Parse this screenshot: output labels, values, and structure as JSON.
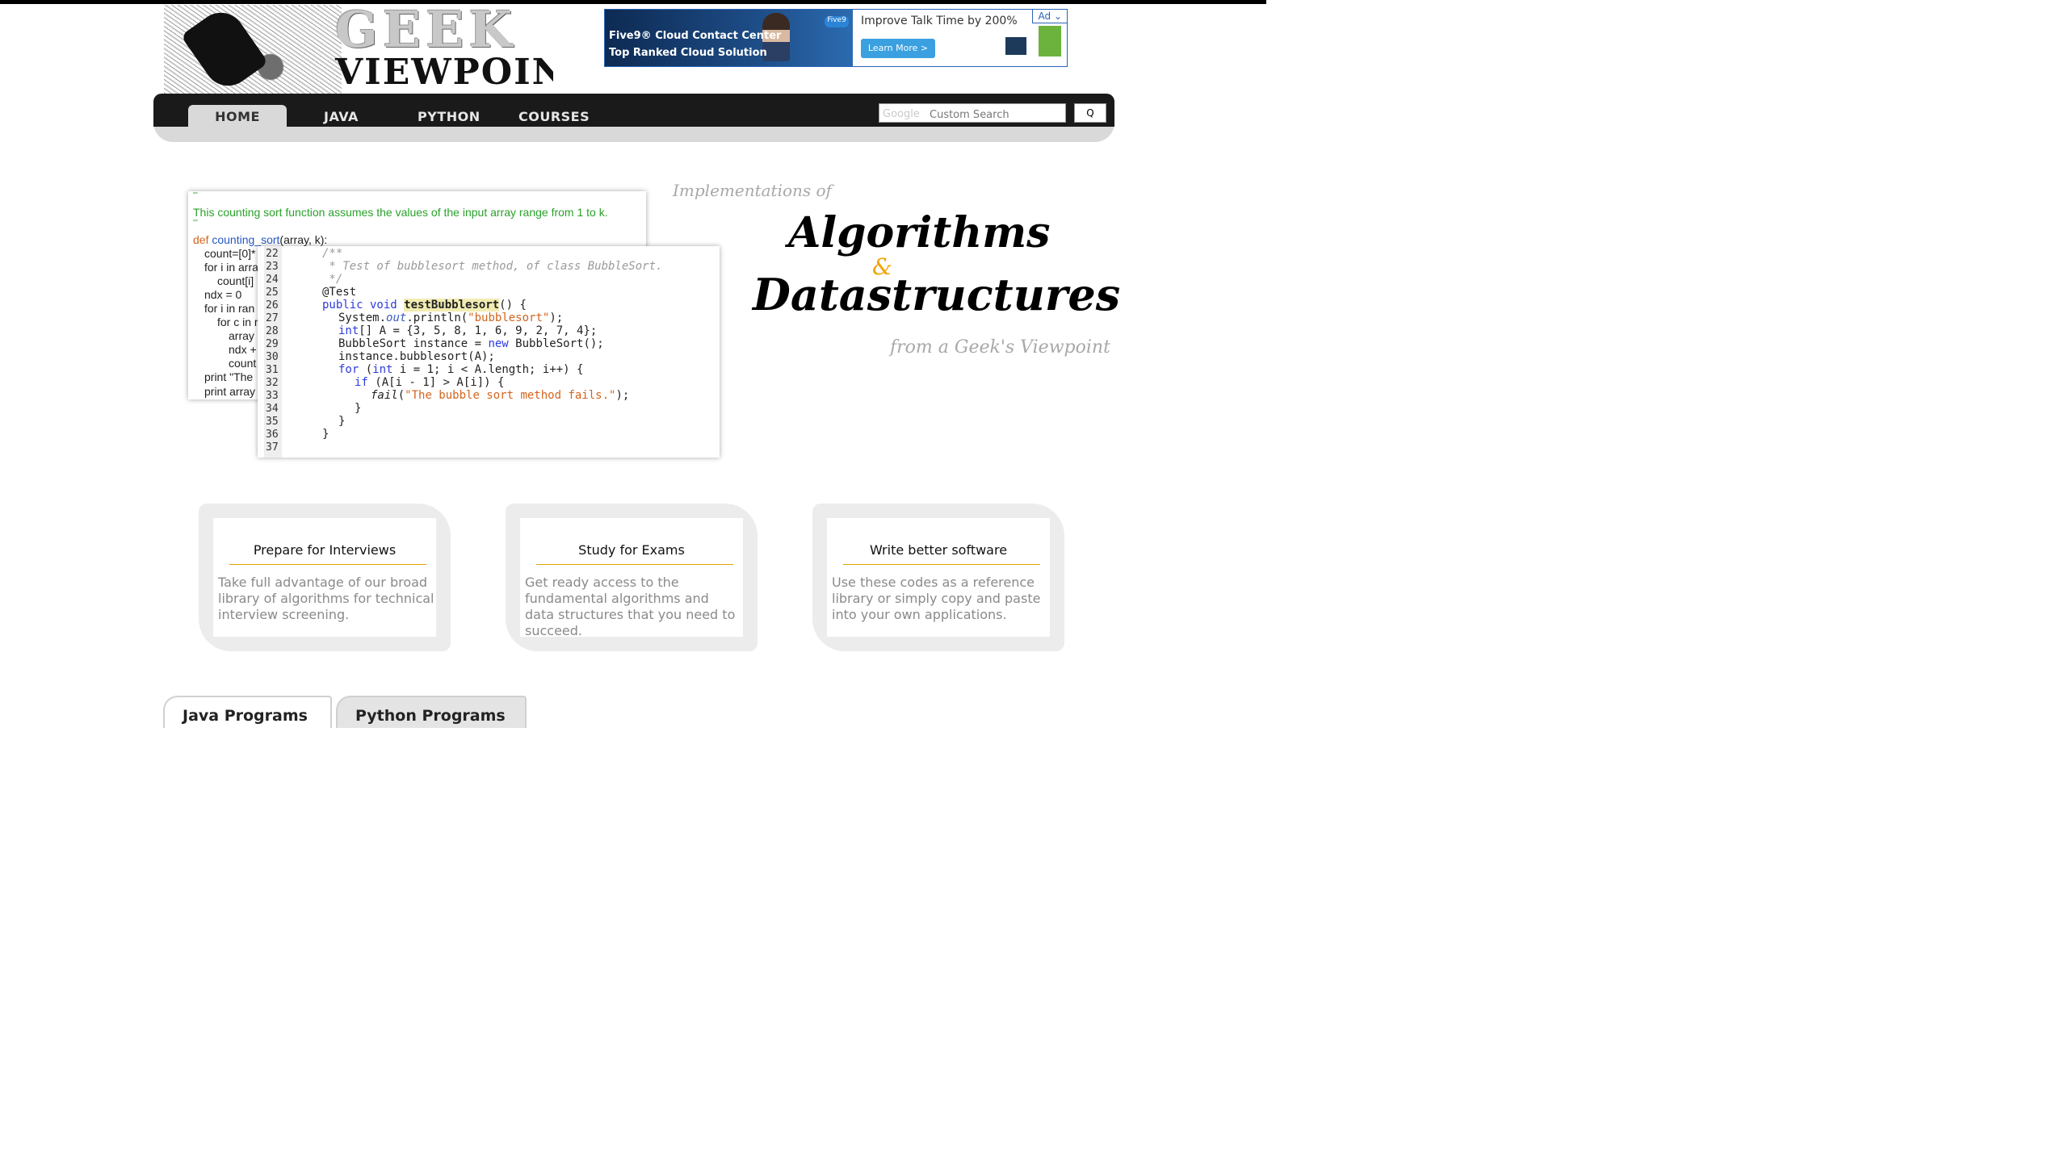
{
  "logo": {
    "word1": "GEEK",
    "word2": "VIEWPOINT"
  },
  "ad": {
    "line1": "Five9® Cloud Contact Center",
    "line2": "Top Ranked Cloud Solution",
    "brand": "Five9",
    "headline": "Improve Talk Time by 200%",
    "cta": "Learn More  >",
    "badge": "Ad",
    "badge_icon": "chevron-down-icon"
  },
  "nav": {
    "tabs": [
      {
        "label": "HOME",
        "active": true
      },
      {
        "label": "JAVA"
      },
      {
        "label": "PYTHON"
      },
      {
        "label": "COURSES"
      }
    ],
    "search": {
      "logo_text": "Google",
      "placeholder": "Custom Search",
      "button_label": "Q"
    }
  },
  "python_code": {
    "docstring_open": "'''",
    "comment": "This counting sort function assumes the values of the input array range from 1 to k.",
    "docstring_close": "'''",
    "def_kw": "def",
    "fn_name": "counting_sort",
    "params": "(array, k):",
    "lines": [
      "count=[0]*",
      "for i in arra",
      "count[i]",
      "ndx = 0",
      "for i in ran",
      "for c in r",
      "array",
      "ndx +",
      "count",
      "print \"The",
      "print array"
    ]
  },
  "java_code": {
    "line_numbers": [
      "22",
      "23",
      "24",
      "25",
      "26",
      "27",
      "28",
      "29",
      "30",
      "31",
      "32",
      "33",
      "34",
      "35",
      "36",
      "37"
    ],
    "comment1": "/**",
    "comment2": " * Test of bubblesort method, of class BubbleSort.",
    "comment3": " */",
    "annotation": "@Test",
    "sig_kw": "public void",
    "sig_name": "testBubblesort",
    "sig_rest": "() {",
    "l27a": "System.",
    "l27b": "out",
    "l27c": ".println(",
    "l27d": "\"bubblesort\"",
    "l27e": ");",
    "l28a": "int",
    "l28b": "[] A = {3, 5, 8, 1, 6, 9, 2, 7, 4};",
    "l29a": "BubbleSort instance = ",
    "l29b": "new",
    "l29c": " BubbleSort();",
    "l30": "instance.bubblesort(A);",
    "l31a": "for",
    "l31b": " (",
    "l31c": "int",
    "l31d": " i = 1; i < A.length; i++) {",
    "l32a": "if",
    "l32b": " (A[i - 1] > A[i]) {",
    "l33a": "fail",
    "l33b": "(",
    "l33c": "\"The bubble sort method fails.\"",
    "l33d": ");",
    "l34": "}",
    "l35": "}",
    "l36": "}"
  },
  "hero": {
    "intro": "Implementations of",
    "word1": "Algorithms",
    "amp": "&",
    "word2": "Datastructures",
    "tagline": "from a Geek's Viewpoint"
  },
  "cards": [
    {
      "title": "Prepare for Interviews",
      "body": "Take full advantage of our broad library of algorithms for technical interview screening."
    },
    {
      "title": "Study for Exams",
      "body": "Get ready access to the fundamental algorithms and data structures that you need to succeed."
    },
    {
      "title": "Write better software",
      "body": "Use these codes as a reference library or simply copy and paste into your own applications."
    }
  ],
  "bottom_tabs": [
    "Java Programs",
    "Python Programs"
  ]
}
